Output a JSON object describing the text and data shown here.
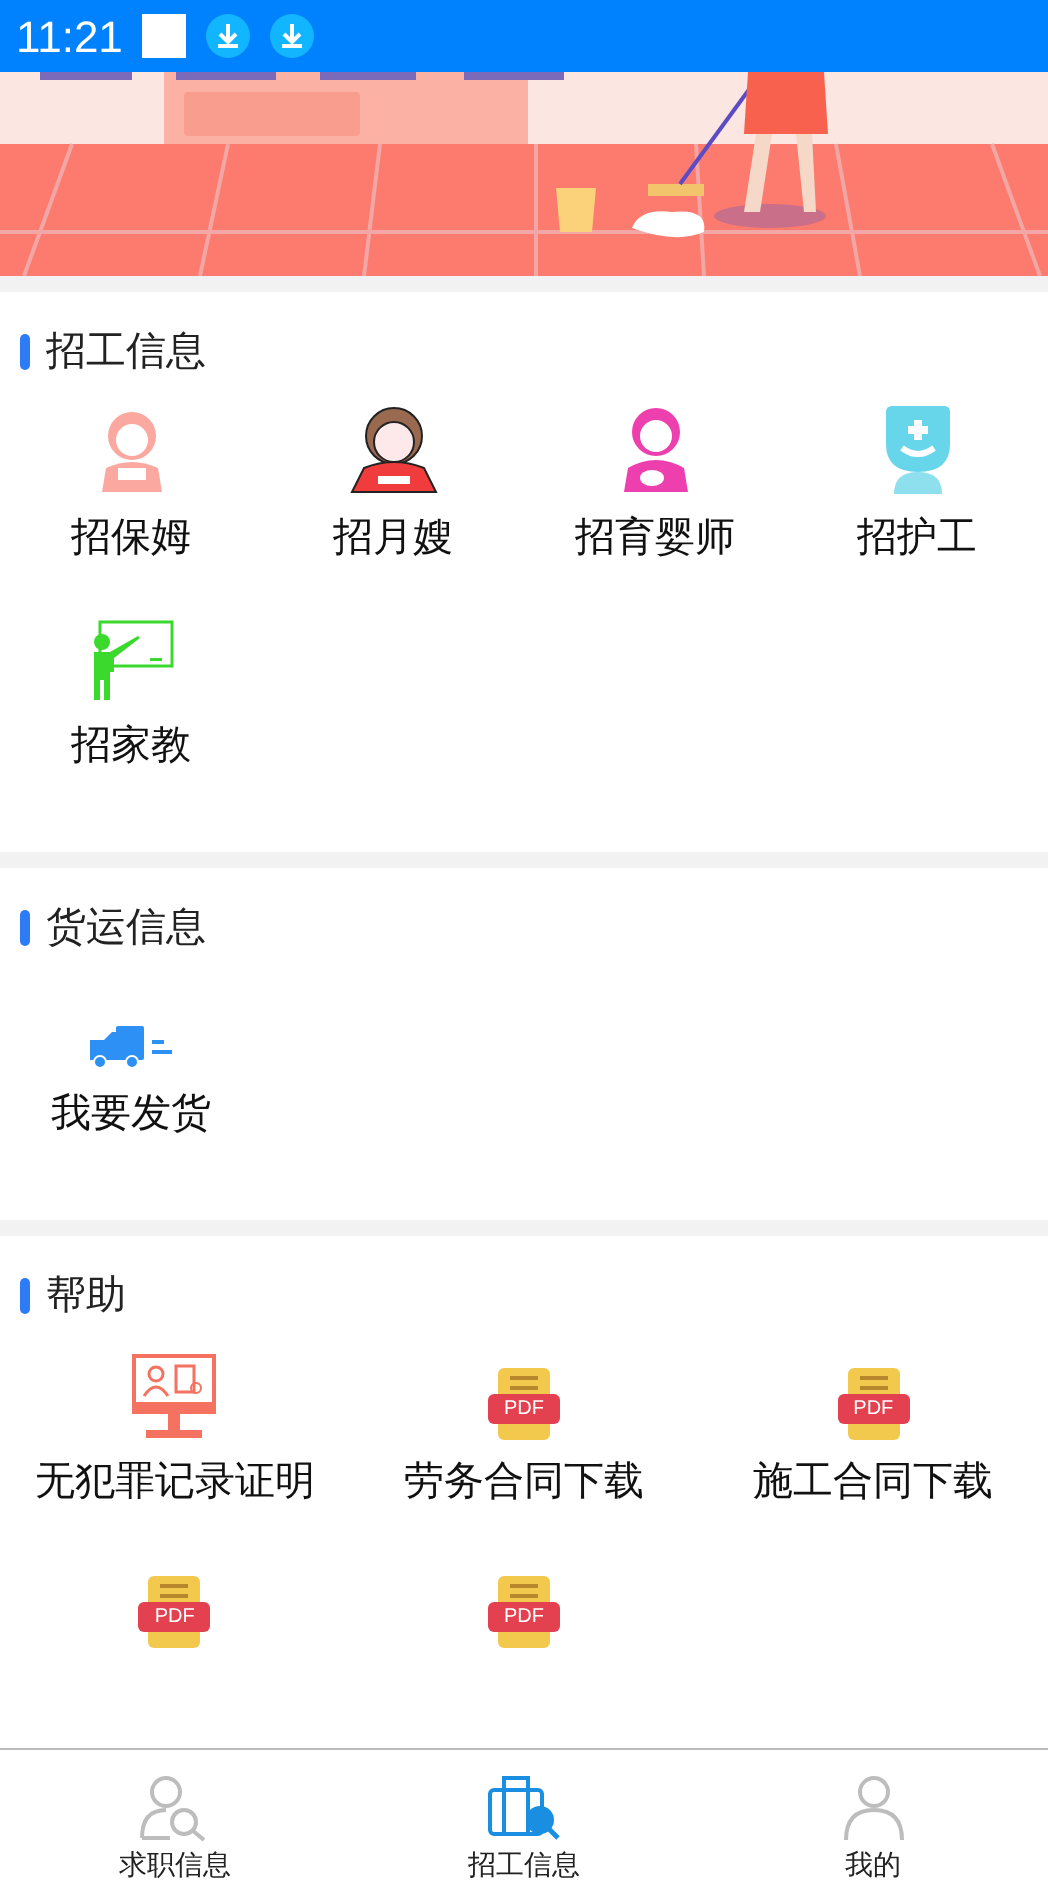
{
  "status_bar": {
    "time": "11:21"
  },
  "sections": [
    {
      "title": "招工信息",
      "items": [
        {
          "label": "招保姆",
          "kind": "nanny"
        },
        {
          "label": "招月嫂",
          "kind": "maternity"
        },
        {
          "label": "招育婴师",
          "kind": "babycare"
        },
        {
          "label": "招护工",
          "kind": "nurse"
        },
        {
          "label": "招家教",
          "kind": "tutor"
        }
      ]
    },
    {
      "title": "货运信息",
      "items": [
        {
          "label": "我要发货",
          "kind": "truck"
        }
      ]
    },
    {
      "title": "帮助",
      "items": [
        {
          "label": "无犯罪记录证明",
          "kind": "monitor"
        },
        {
          "label": "劳务合同下载",
          "kind": "pdf",
          "badge": "PDF"
        },
        {
          "label": "施工合同下载",
          "kind": "pdf",
          "badge": "PDF"
        },
        {
          "kind": "pdf",
          "badge": "PDF"
        },
        {
          "kind": "pdf",
          "badge": "PDF"
        }
      ]
    }
  ],
  "tab_bar": [
    {
      "label": "求职信息",
      "kind": "person-search",
      "selected": false
    },
    {
      "label": "招工信息",
      "kind": "briefcase-search",
      "selected": true
    },
    {
      "label": "我的",
      "kind": "person",
      "selected": false
    }
  ]
}
